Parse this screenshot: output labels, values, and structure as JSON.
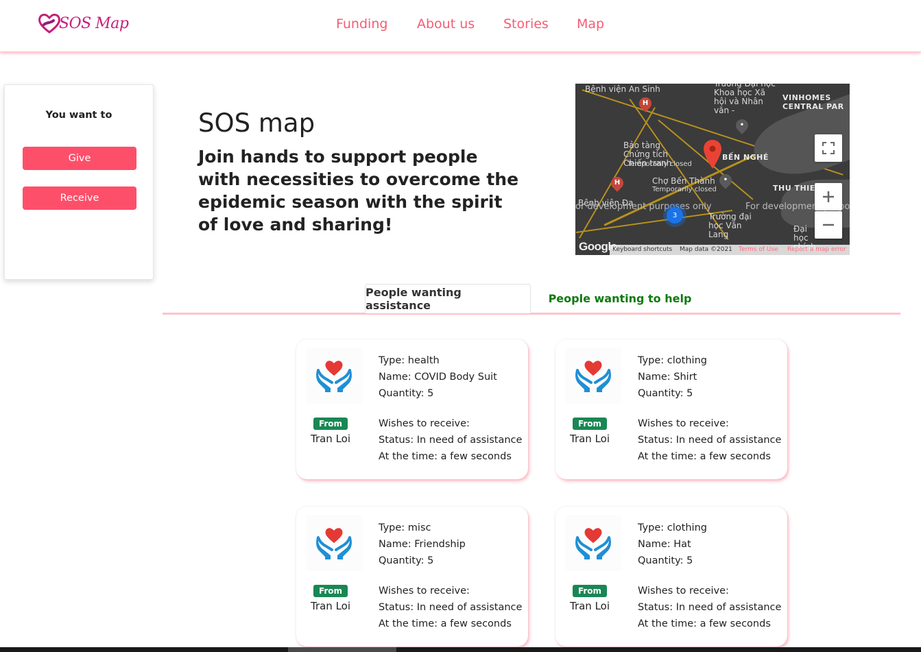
{
  "brand": {
    "name": "SOS Map"
  },
  "nav": {
    "items": [
      "Funding",
      "About us",
      "Stories",
      "Map"
    ]
  },
  "sidebar": {
    "title": "You want to",
    "give_label": "Give",
    "receive_label": "Receive"
  },
  "hero": {
    "title": "SOS map",
    "subtitle": "Join hands to support people with necessities to overcome the epidemic season with the spirit of love and sharing!"
  },
  "map": {
    "labels": [
      "Bệnh viện An Sinh",
      "Trường Đại học Khoa học Xã hội và Nhân văn -",
      "VINHOMES CENTRAL PAR",
      "Bảo tàng Chứng tích Chiến tranh",
      "Temporarily closed",
      "BẾN NGHÉ",
      "Chợ Bến Thành",
      "Temporarily closed",
      "THU THIEM",
      "Bệnh viện Đa",
      "Trường đại học Văn Lang",
      "Đại học chính",
      "or development purposes only",
      "For development purposes only",
      "3"
    ],
    "footer": {
      "shortcuts": "Keyboard shortcuts",
      "data": "Map data ©2021",
      "terms": "Terms of Use",
      "report": "Report a map error"
    },
    "google": "Google"
  },
  "tabs": {
    "active": "People wanting assistance",
    "inactive": "People wanting to help"
  },
  "cards": [
    {
      "badge": "From",
      "from": "Tran Loi",
      "type": "Type: health",
      "name": "Name: COVID Body Suit",
      "quantity": "Quantity: 5",
      "wishes": "Wishes to receive:",
      "status": "Status: In need of assistance",
      "time": "At the time: a few seconds"
    },
    {
      "badge": "From",
      "from": "Tran Loi",
      "type": "Type: clothing",
      "name": "Name: Shirt",
      "quantity": "Quantity: 5",
      "wishes": "Wishes to receive:",
      "status": "Status: In need of assistance",
      "time": "At the time: a few seconds"
    },
    {
      "badge": "From",
      "from": "Tran Loi",
      "type": "Type: misc",
      "name": "Name: Friendship",
      "quantity": "Quantity: 5",
      "wishes": "Wishes to receive:",
      "status": "Status: In need of assistance",
      "time": "At the time: a few seconds"
    },
    {
      "badge": "From",
      "from": "Tran Loi",
      "type": "Type: clothing",
      "name": "Name: Hat",
      "quantity": "Quantity: 5",
      "wishes": "Wishes to receive:",
      "status": "Status: In need of assistance",
      "time": "At the time: a few seconds"
    }
  ],
  "colors": {
    "accent": "#fd4f6a",
    "nav_link": "#f55c73",
    "badge": "#198754",
    "tab_inactive": "#0d7a0d"
  },
  "icons": [
    "heart-hands-icon",
    "fullscreen-icon",
    "zoom-in-icon",
    "zoom-out-icon",
    "map-marker-icon"
  ]
}
